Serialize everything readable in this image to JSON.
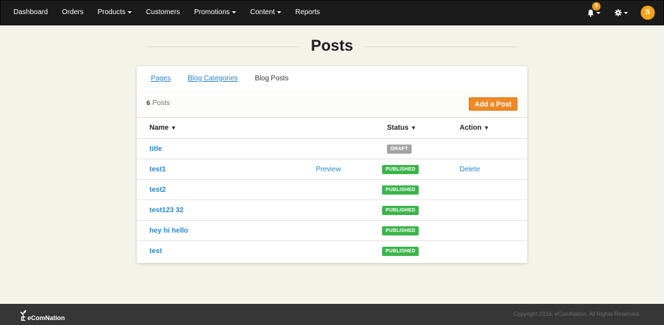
{
  "nav": {
    "items": [
      {
        "label": "Dashboard",
        "has_dropdown": false
      },
      {
        "label": "Orders",
        "has_dropdown": false
      },
      {
        "label": "Products",
        "has_dropdown": true
      },
      {
        "label": "Customers",
        "has_dropdown": false
      },
      {
        "label": "Promotions",
        "has_dropdown": true
      },
      {
        "label": "Content",
        "has_dropdown": true
      },
      {
        "label": "Reports",
        "has_dropdown": false
      }
    ],
    "notifications_count": "5",
    "notification_icon": "bell-icon",
    "settings_icon": "gear-icon",
    "avatar_initial": "S",
    "avatar_color": "#f3a41c"
  },
  "page": {
    "title": "Posts"
  },
  "tabs": [
    {
      "label": "Pages",
      "active": false
    },
    {
      "label": "Blog Categories",
      "active": false
    },
    {
      "label": "Blog Posts",
      "active": true
    }
  ],
  "summary": {
    "count": "6",
    "count_label": "Posts",
    "add_button_label": "Add a Post"
  },
  "table": {
    "columns": {
      "name": "Name",
      "status": "Status",
      "action": "Action"
    },
    "sort_icon": "▼",
    "rows": [
      {
        "name": "title",
        "preview": "",
        "status": "DRAFT",
        "status_type": "draft",
        "action": ""
      },
      {
        "name": "test1",
        "preview": "Preview",
        "status": "PUBLISHED",
        "status_type": "published",
        "action": "Delete"
      },
      {
        "name": "test2",
        "preview": "",
        "status": "PUBLISHED",
        "status_type": "published",
        "action": ""
      },
      {
        "name": "test123 32",
        "preview": "",
        "status": "PUBLISHED",
        "status_type": "published",
        "action": ""
      },
      {
        "name": "hey hi hello",
        "preview": "",
        "status": "PUBLISHED",
        "status_type": "published",
        "action": ""
      },
      {
        "name": "test",
        "preview": "",
        "status": "PUBLISHED",
        "status_type": "published",
        "action": ""
      }
    ]
  },
  "colors": {
    "accent_orange": "#ed8a25",
    "link_blue": "#2a86c9",
    "published_green": "#3bb44a",
    "draft_gray": "#a4a4a4",
    "navbar": "#1b1b1b",
    "footer": "#363636",
    "page_bg": "#f4f3ea"
  },
  "footer": {
    "brand": "eComNation",
    "brand_icon": "sprout-icon",
    "copyright": "Copyright 2016, eComNation. All Rights Reserved."
  }
}
